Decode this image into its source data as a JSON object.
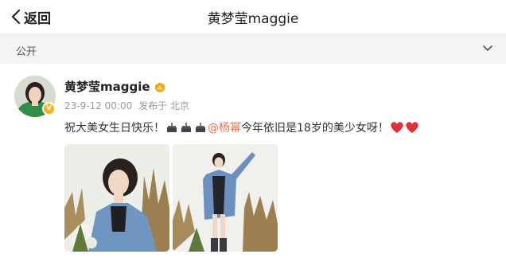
{
  "header": {
    "back_label": "返回",
    "title": "黄梦莹maggie"
  },
  "filter": {
    "label": "公开"
  },
  "post": {
    "author": "黄梦莹maggie",
    "time": "23-9-12 00:00",
    "source": "发布于 北京",
    "text_before": "祝大美女生日快乐！",
    "mention": "@杨幂",
    "text_after": " 今年依旧是18岁的美少女呀！"
  },
  "colors": {
    "mention": "#eb7350",
    "verify_badge": "#f6b21c",
    "heart": "#e0303a"
  },
  "icons": [
    "back-chevron-icon",
    "chevron-down-icon",
    "crown-icon",
    "verified-icon",
    "cake-icon",
    "heart-icon"
  ]
}
